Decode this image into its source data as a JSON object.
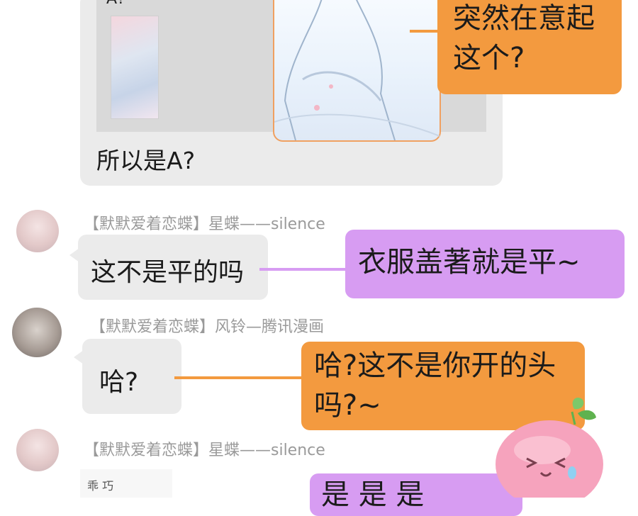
{
  "colors": {
    "orange_annotation": "#f39a3f",
    "purple_annotation": "#d79cf2",
    "bubble_gray": "#ebebeb",
    "nickname_gray": "#9a9a9a"
  },
  "quoted_message": {
    "top_label": "A?",
    "text": "所以是A?"
  },
  "annotations": {
    "top": "突然在意起这个?",
    "clothes": "衣服盖著就是平~",
    "ha_reply": "哈?这不是你开的头吗?~",
    "bottom_partial": "是 是 是"
  },
  "messages": [
    {
      "sender": "【默默爱着恋蝶】星蝶——silence",
      "text": "这不是平的吗"
    },
    {
      "sender": "【默默爱着恋蝶】风铃—腾讯漫画",
      "text": "哈?"
    },
    {
      "sender": "【默默爱着恋蝶】星蝶——silence",
      "image_text": "乖 巧"
    }
  ],
  "icons": [
    "avatar-xingdie",
    "avatar-fengling",
    "pink-mascot-sticker"
  ]
}
